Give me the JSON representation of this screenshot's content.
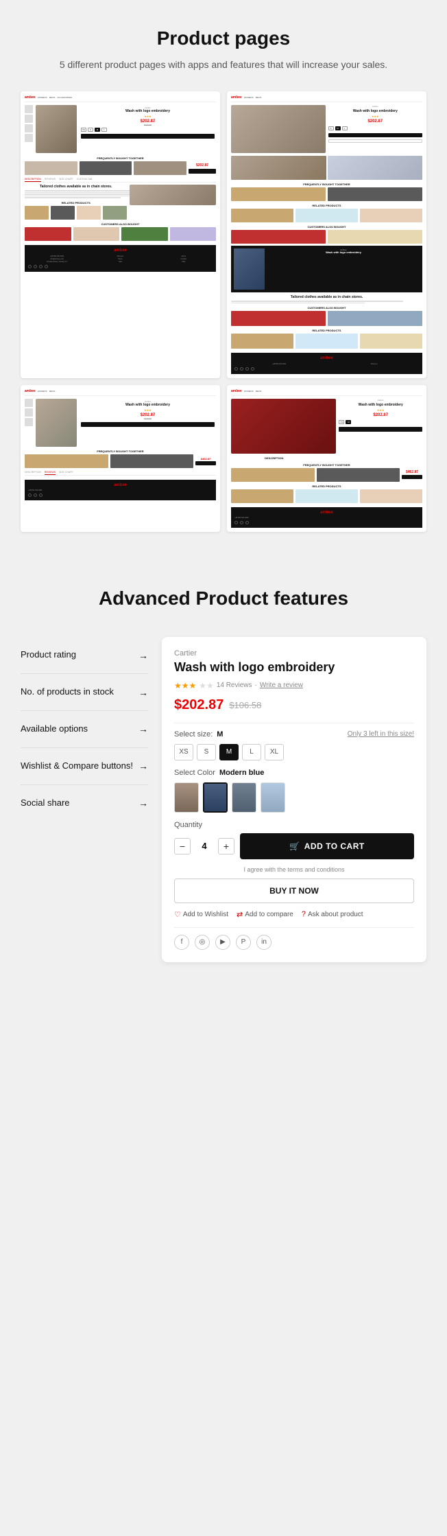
{
  "section1": {
    "title": "Product pages",
    "subtitle": "5 different product pages with apps and features\nthat will increase your sales."
  },
  "section2": {
    "title": "Advanced\nProduct features",
    "features": [
      {
        "id": "product-rating",
        "label": "Product rating",
        "has_arrow": true
      },
      {
        "id": "no-of-products",
        "label": "No. of products\nin stock",
        "has_arrow": true
      },
      {
        "id": "available-options",
        "label": "Available\noptions",
        "has_arrow": true
      },
      {
        "id": "wishlist-compare",
        "label": "Wishlist\n& Compare\nbuttons!",
        "has_arrow": true
      },
      {
        "id": "social-share",
        "label": "Social share",
        "has_arrow": true
      }
    ]
  },
  "product_demo": {
    "brand": "Cartier",
    "name": "Wash with logo embroidery",
    "stars_count": 3,
    "stars_label": "★★★",
    "review_count": "14 Reviews",
    "write_review": "Write a review",
    "price_current": "$202.87",
    "price_old": "$106.58",
    "select_size_label": "Select size:",
    "select_size_value": "M",
    "size_guide_link": "Only 3 left in this size!",
    "sizes": [
      "XS",
      "S",
      "M",
      "L",
      "XL"
    ],
    "active_size": "M",
    "select_color_label": "Select Color",
    "select_color_value": "Modern blue",
    "quantity_label": "Quantity",
    "quantity_value": "4",
    "add_to_cart_label": "ADD TO CART",
    "terms_text": "I agree with the terms and conditions",
    "buy_now_label": "BUY IT NOW",
    "action_wishlist": "Add to Wishlist",
    "action_compare": "Add to compare",
    "action_ask": "Ask about product",
    "social_icons": [
      "f",
      "◎",
      "▶",
      "P",
      "in"
    ]
  },
  "mockup1": {
    "brand": "ambee",
    "product_name": "Wash with logo embroidery",
    "price": "$202.87",
    "old_price": "$106.58",
    "section_fbt": "FREQUENTLY BOUGHT TOGETHER",
    "section_desc": "DESCRIPTION",
    "section_reviews": "REVIEWS",
    "section_size": "SIZE CHART",
    "section_custom": "CUSTOM TAB",
    "section_related": "RELATED PRODUCTS",
    "section_also": "CUSTOMERS ALSO BOUGHT",
    "desc_text": "Tailored clothes available as in chain stores."
  },
  "mockup2": {
    "brand": "ambee",
    "product_name": "Wash with logo embroidery",
    "price": "$202.87",
    "section_fbt": "FREQUENTLY BOUGHT TOGETHER",
    "section_related": "RELATED PRODUCTS",
    "section_also": "CUSTOMERS ALSO BOUGHT"
  },
  "icons": {
    "arrow_right": "→",
    "cart": "🛒",
    "heart": "♡",
    "compare": "⇄",
    "question": "?",
    "facebook": "f",
    "instagram": "◎",
    "youtube": "▶",
    "pinterest": "P",
    "linkedin": "in",
    "star_filled": "★",
    "star_empty": "☆"
  }
}
